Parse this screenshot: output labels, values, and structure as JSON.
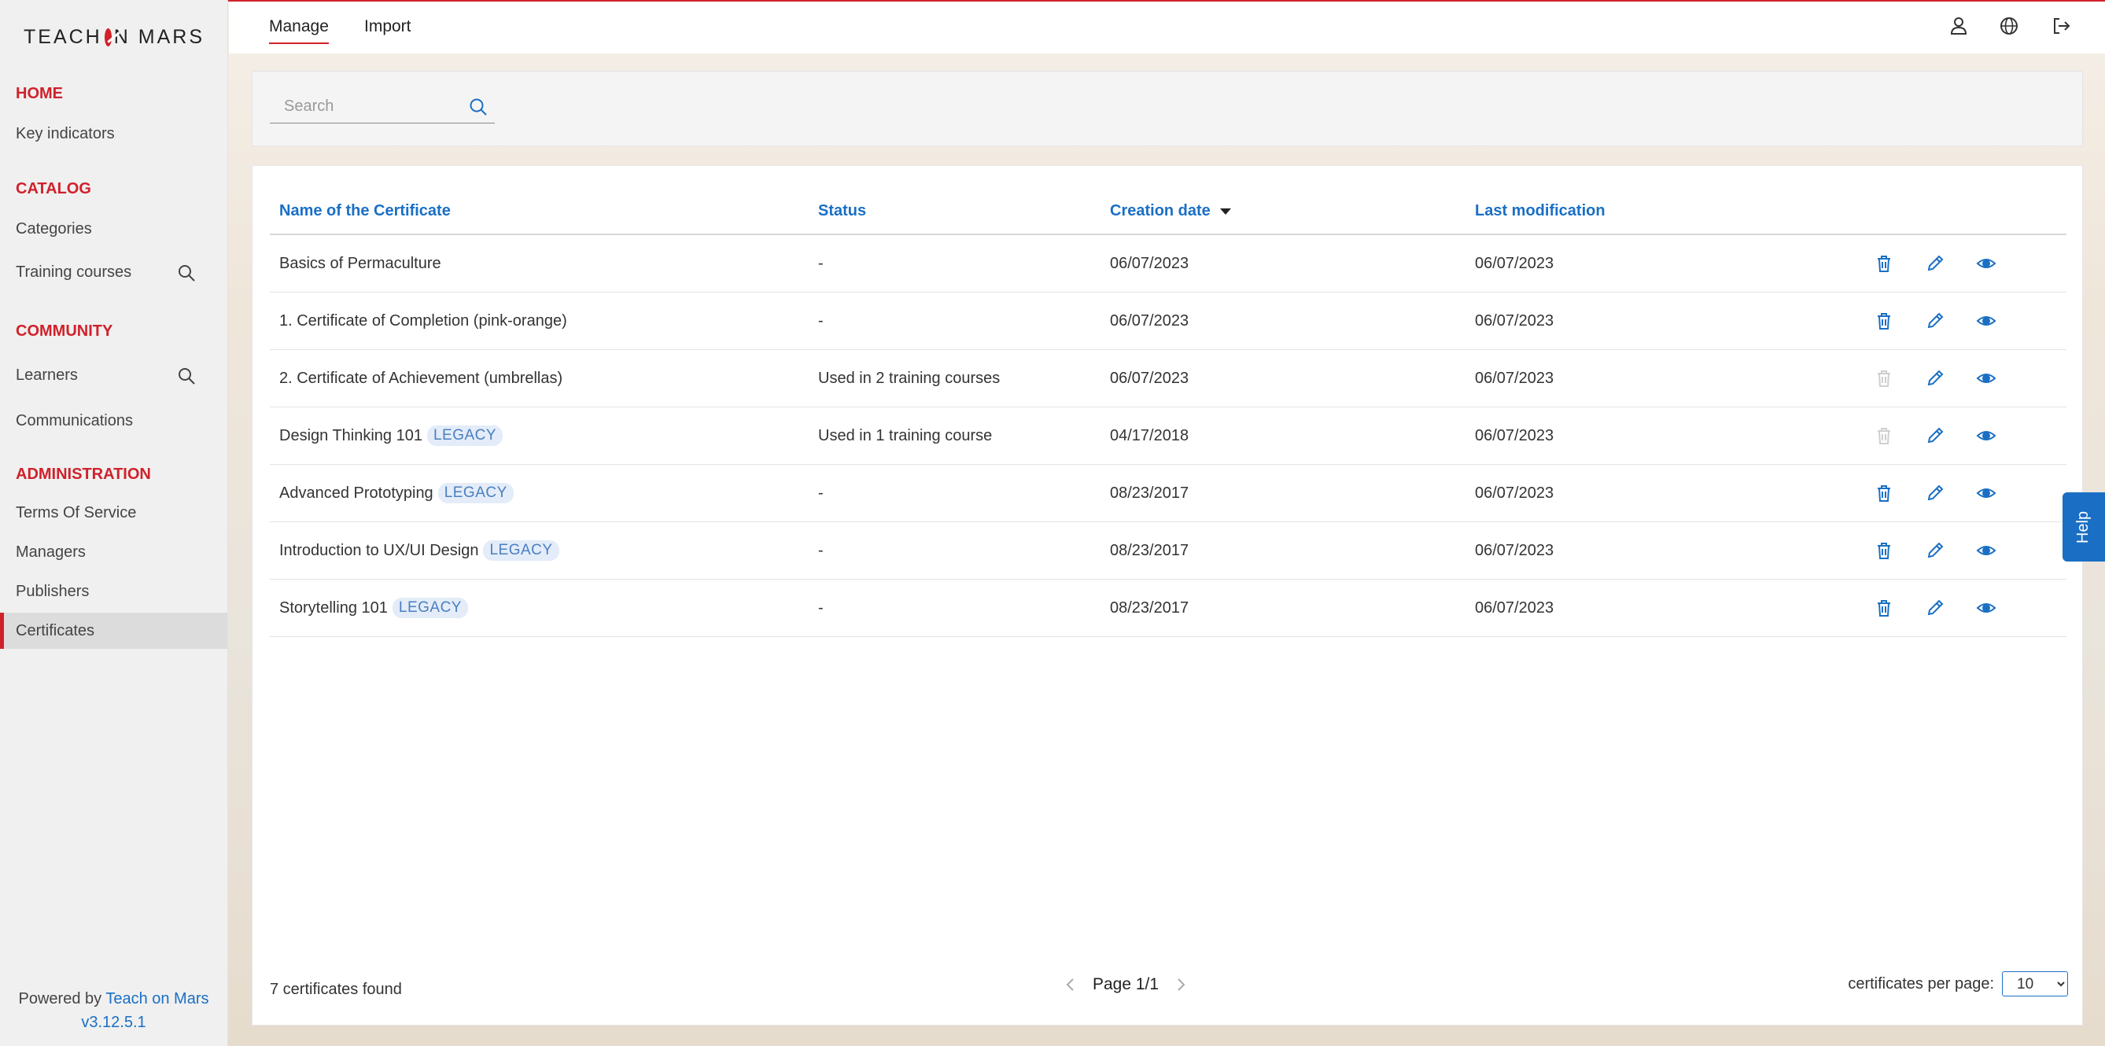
{
  "brand": {
    "logo_text_left": "TEACH",
    "logo_text_right": "N MARS",
    "accent": "#d0212b",
    "link": "#1a6fc4"
  },
  "sidebar": {
    "sections": [
      {
        "title": "HOME",
        "items": [
          {
            "label": "Key indicators"
          }
        ]
      },
      {
        "title": "CATALOG",
        "items": [
          {
            "label": "Categories"
          },
          {
            "label": "Training courses",
            "icon": "search-icon"
          }
        ]
      },
      {
        "title": "COMMUNITY",
        "items": [
          {
            "label": "Learners",
            "icon": "search-icon"
          },
          {
            "label": "Communications"
          }
        ]
      },
      {
        "title": "ADMINISTRATION",
        "items": [
          {
            "label": "Terms Of Service"
          },
          {
            "label": "Managers"
          },
          {
            "label": "Publishers"
          },
          {
            "label": "Certificates",
            "active": true
          }
        ]
      }
    ],
    "powered_prefix": "Powered by",
    "powered_link": "Teach on Mars",
    "version": "v3.12.5.1"
  },
  "topbar": {
    "tabs": [
      {
        "label": "Manage",
        "active": true
      },
      {
        "label": "Import"
      }
    ],
    "icons": [
      "user-icon",
      "globe-icon",
      "logout-icon"
    ]
  },
  "search": {
    "placeholder": "Search",
    "value": ""
  },
  "table": {
    "columns": [
      "Name of the Certificate",
      "Status",
      "Creation date",
      "Last modification"
    ],
    "sort_column": "Creation date",
    "rows": [
      {
        "name": "Basics of Permaculture",
        "legacy": "",
        "status": "-",
        "created": "06/07/2023",
        "modified": "06/07/2023",
        "delete_enabled": true
      },
      {
        "name": "1. Certificate of Completion (pink-orange)",
        "legacy": "",
        "status": "-",
        "created": "06/07/2023",
        "modified": "06/07/2023",
        "delete_enabled": true
      },
      {
        "name": "2. Certificate of Achievement (umbrellas)",
        "legacy": "",
        "status": "Used in 2 training courses",
        "created": "06/07/2023",
        "modified": "06/07/2023",
        "delete_enabled": false
      },
      {
        "name": "Design Thinking 101",
        "legacy": "LEGACY",
        "status": "Used in 1 training course",
        "created": "04/17/2018",
        "modified": "06/07/2023",
        "delete_enabled": false
      },
      {
        "name": "Advanced Prototyping",
        "legacy": "LEGACY",
        "status": "-",
        "created": "08/23/2017",
        "modified": "06/07/2023",
        "delete_enabled": true
      },
      {
        "name": "Introduction to UX/UI Design",
        "legacy": "LEGACY",
        "status": "-",
        "created": "08/23/2017",
        "modified": "06/07/2023",
        "delete_enabled": true
      },
      {
        "name": "Storytelling 101",
        "legacy": "LEGACY",
        "status": "-",
        "created": "08/23/2017",
        "modified": "06/07/2023",
        "delete_enabled": true
      }
    ]
  },
  "footer": {
    "count_text": "7 certificates found",
    "page_text": "Page 1/1",
    "per_page_label": "certificates per page:",
    "per_page_value": "10"
  },
  "help": {
    "label": "Help"
  }
}
